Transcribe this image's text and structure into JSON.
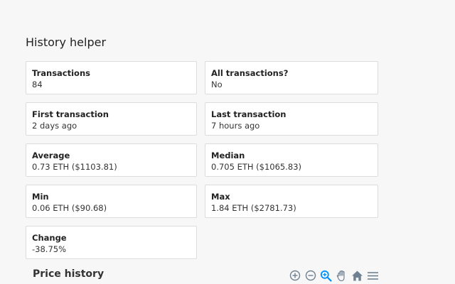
{
  "header": {
    "title": "History helper"
  },
  "stats": {
    "transactions": {
      "label": "Transactions",
      "value": "84"
    },
    "all_transactions": {
      "label": "All transactions?",
      "value": "No"
    },
    "first_transaction": {
      "label": "First transaction",
      "value": "2 days ago"
    },
    "last_transaction": {
      "label": "Last transaction",
      "value": "7 hours ago"
    },
    "average": {
      "label": "Average",
      "value": "0.73 ETH ($1103.81)"
    },
    "median": {
      "label": "Median",
      "value": "0.705 ETH ($1065.83)"
    },
    "min": {
      "label": "Min",
      "value": "0.06 ETH ($90.68)"
    },
    "max": {
      "label": "Max",
      "value": "1.84 ETH ($2781.73)"
    },
    "change": {
      "label": "Change",
      "value": "-38.75%"
    }
  },
  "chart": {
    "title": "Price history",
    "toolbar": [
      "zoom-in-icon",
      "zoom-out-icon",
      "selection-zoom-icon",
      "pan-icon",
      "reset-home-icon",
      "menu-icon"
    ]
  },
  "colors": {
    "toolbar_inactive": "#6e8192",
    "toolbar_active": "#008ffb"
  }
}
